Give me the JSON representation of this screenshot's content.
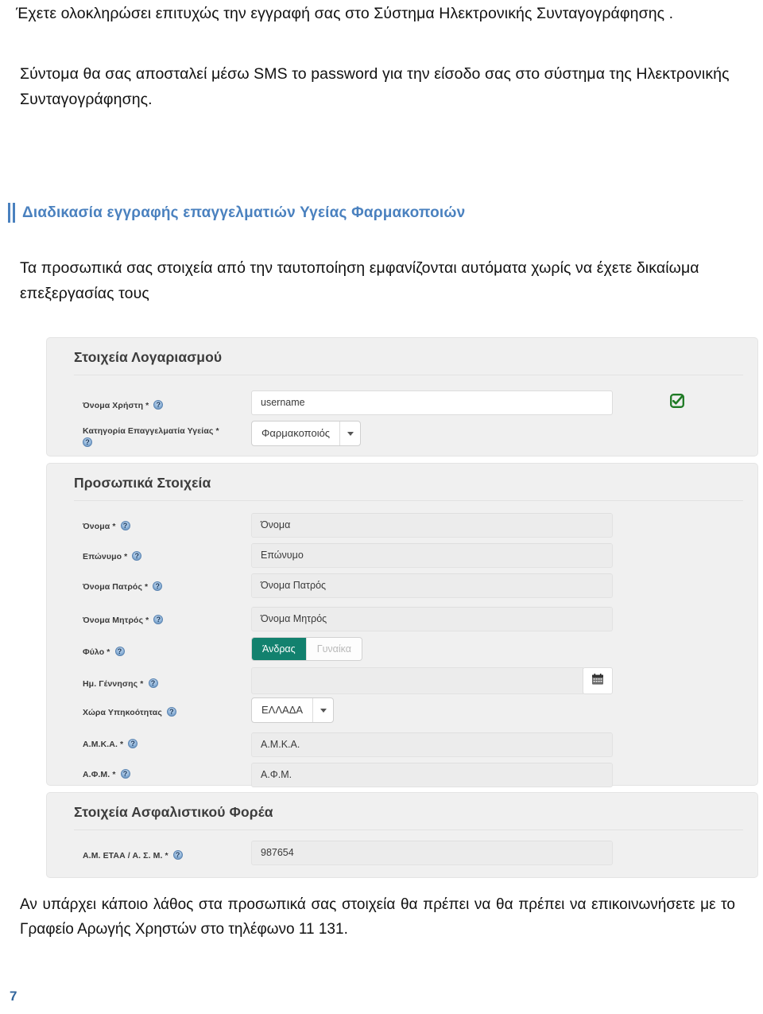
{
  "document": {
    "intro_paragraph_1": "Έχετε ολοκληρώσει επιτυχώς την εγγραφή σας στο Σύστημα Ηλεκτρονικής Συνταγογράφησης .",
    "intro_paragraph_2": "Σύντομα θα σας αποσταλεί μέσω SMS το password για την είσοδο σας στο σύστημα της Ηλεκτρονικής Συνταγογράφησης.",
    "section_heading": "Διαδικασία εγγραφής επαγγελματιών Υγείας  Φαρμακοποιών",
    "note_paragraph": "Τα προσωπικά σας στοιχεία από την ταυτοποίηση εμφανίζονται αυτόματα χωρίς να έχετε δικαίωμα επεξεργασίας τους",
    "footer_paragraph": "Αν υπάρχει κάποιο λάθος στα προσωπικά σας στοιχεία θα πρέπει να θα πρέπει να επικοινωνήσετε με το Γραφείο Αρωγής Χρηστών στο τηλέφωνο 11 131.",
    "page_number": "7",
    "heading_color": "#4a81bf",
    "accent_teal": "#12816e",
    "valid_green": "#1e7a24"
  },
  "form": {
    "account_section": {
      "title": "Στοιχεία Λογαριασμού",
      "fields": [
        {
          "label": "Όνομα Χρήστη",
          "required": "*",
          "type": "text",
          "value": "username",
          "valid_icon": "check-square-icon"
        },
        {
          "label": "Κατηγορία Επαγγελματία Υγείας",
          "required": "*",
          "type": "select",
          "value": "Φαρμακοποιός"
        }
      ]
    },
    "personal_section": {
      "title": "Προσωπικά Στοιχεία",
      "fields": [
        {
          "label": "Όνομα",
          "required": "*",
          "type": "readonly",
          "value": "Όνομα"
        },
        {
          "label": "Επώνυμο",
          "required": "*",
          "type": "readonly",
          "value": "Επώνυμο"
        },
        {
          "label": "Όνομα Πατρός",
          "required": "*",
          "type": "readonly",
          "value": "Όνομα Πατρός"
        },
        {
          "label": "Όνομα Μητρός",
          "required": "*",
          "type": "readonly",
          "value": "Όνομα Μητρός"
        },
        {
          "label": "Φύλο",
          "required": "*",
          "type": "toggle",
          "option_active": "Άνδρας",
          "option_inactive": "Γυναίκα"
        },
        {
          "label": "Ημ. Γέννησης",
          "required": "*",
          "type": "date",
          "value": ""
        },
        {
          "label": "Χώρα Υπηκοότητας",
          "required": "",
          "type": "select",
          "value": "ΕΛΛΑΔΑ"
        },
        {
          "label": "Α.Μ.Κ.Α.",
          "required": "*",
          "type": "readonly",
          "value": "Α.Μ.Κ.Α."
        },
        {
          "label": "Α.Φ.Μ.",
          "required": "*",
          "type": "readonly",
          "value": "Α.Φ.Μ."
        }
      ]
    },
    "insurance_section": {
      "title": "Στοιχεία Ασφαλιστικού Φορέα",
      "fields": [
        {
          "label": "Α.Μ. ΕΤΑΑ / Α. Σ. Μ.",
          "required": "*",
          "type": "readonly",
          "value": "987654"
        }
      ]
    }
  }
}
